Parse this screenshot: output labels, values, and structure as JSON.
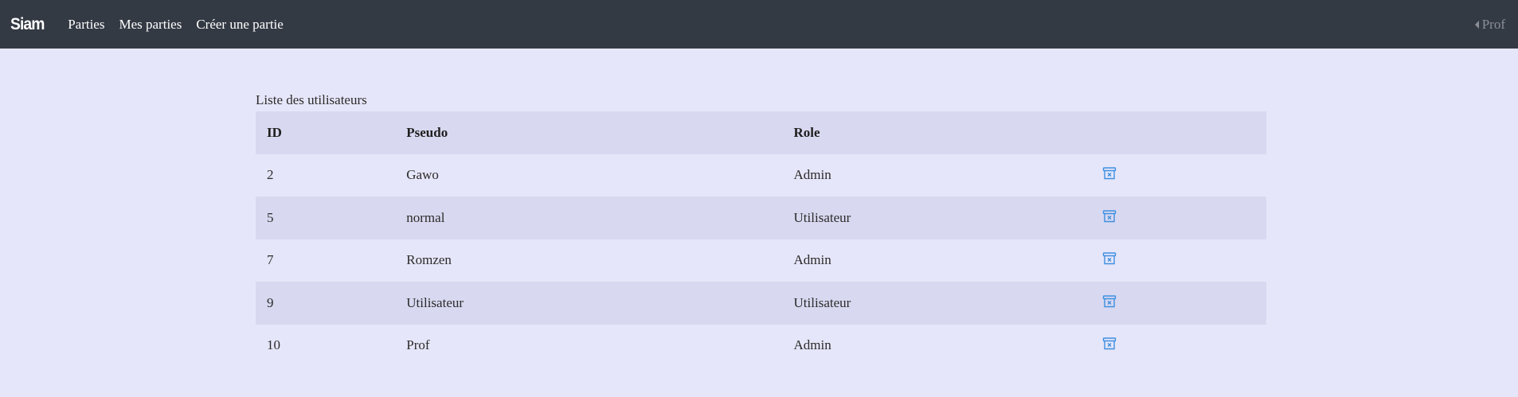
{
  "navbar": {
    "brand": "Siam",
    "links": [
      "Parties",
      "Mes parties",
      "Créer une partie"
    ],
    "user": "Prof"
  },
  "users_table": {
    "caption": "Liste des utilisateurs",
    "headers": [
      "ID",
      "Pseudo",
      "Role",
      ""
    ],
    "rows": [
      {
        "id": "2",
        "pseudo": "Gawo",
        "role": "Admin"
      },
      {
        "id": "5",
        "pseudo": "normal",
        "role": "Utilisateur"
      },
      {
        "id": "7",
        "pseudo": "Romzen",
        "role": "Admin"
      },
      {
        "id": "9",
        "pseudo": "Utilisateur",
        "role": "Utilisateur"
      },
      {
        "id": "10",
        "pseudo": "Prof",
        "role": "Admin"
      }
    ],
    "action_icon": "archive-delete-icon"
  },
  "colors": {
    "navbar_bg": "#343a44",
    "page_bg": "#e6e6fa",
    "stripe_bg": "#d8d8f0",
    "icon_blue": "#3d8fe0"
  }
}
